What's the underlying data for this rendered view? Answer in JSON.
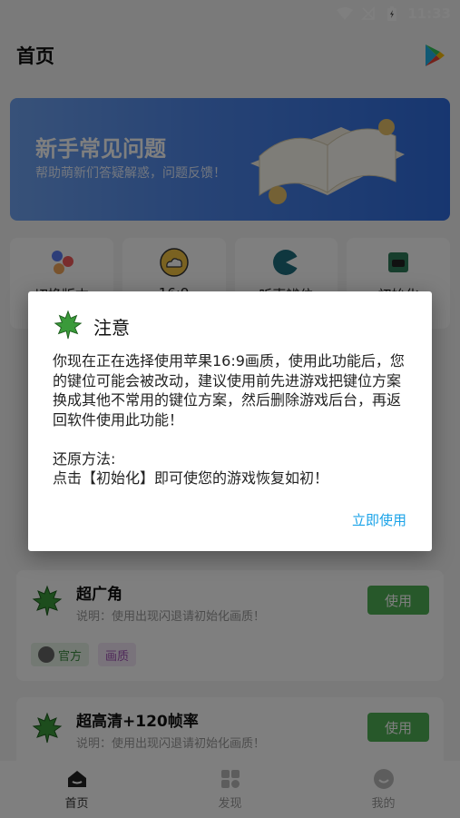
{
  "status_bar": {
    "time": "11:33"
  },
  "app_bar": {
    "title": "首页",
    "play_icon": "play-store-icon"
  },
  "banner": {
    "title": "新手常见问题",
    "subtitle": "帮助萌新们答疑解惑，问题反馈！"
  },
  "quick_actions": [
    {
      "label": "切换版本",
      "icon": "balls-icon"
    },
    {
      "label": "16:9",
      "icon": "cloud-icon"
    },
    {
      "label": "听声辨位",
      "icon": "sound-icon"
    },
    {
      "label": "初始化",
      "icon": "gamepad-icon"
    }
  ],
  "cards": [
    {
      "title": "超广角",
      "desc": "说明：使用出现闪退请初始化画质！",
      "button": "使用",
      "tags": [
        "官方",
        "画质"
      ]
    },
    {
      "title": "超高清+120帧率",
      "desc": "说明：使用出现闪退请初始化画质！",
      "button": "使用"
    }
  ],
  "bottom_nav": [
    {
      "label": "首页",
      "icon": "home-icon",
      "active": true
    },
    {
      "label": "发现",
      "icon": "grid-icon",
      "active": false
    },
    {
      "label": "我的",
      "icon": "smiley-icon",
      "active": false
    }
  ],
  "dialog": {
    "title": "注意",
    "body": "你现在正在选择使用苹果16:9画质，使用此功能后，您的键位可能会被改动，建议使用前先进游戏把键位方案换成其他不常用的键位方案，然后删除游戏后台，再返回软件使用此功能！\n\n还原方法:\n点击【初始化】即可使您的游戏恢复如初！",
    "action": "立即使用"
  },
  "colors": {
    "accent_green": "#4fb155",
    "link_blue": "#1aa3e8",
    "banner_blue": "#2f6de0"
  }
}
